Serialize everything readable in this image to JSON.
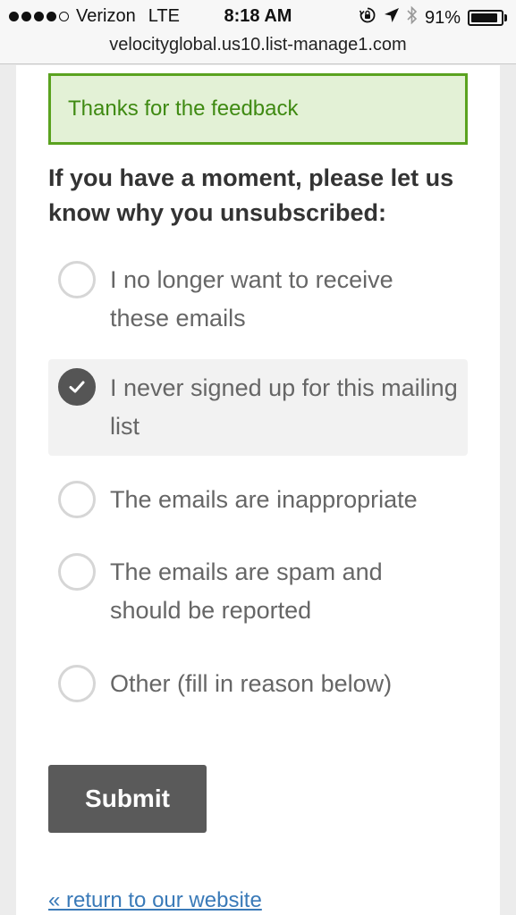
{
  "status_bar": {
    "carrier": "Verizon",
    "network": "LTE",
    "time": "8:18 AM",
    "battery": "91%",
    "battery_level": 0.91,
    "signal_bars_filled": 4,
    "signal_bars_total": 5,
    "icons": [
      "rotation-lock-icon",
      "location-arrow-icon",
      "bluetooth-icon",
      "battery-icon"
    ]
  },
  "browser": {
    "url": "velocityglobal.us10.list-manage1.com"
  },
  "alert": {
    "text": "Thanks for the feedback",
    "color": "#3f8a12"
  },
  "form": {
    "question": "If you have a moment, please let us know why you unsubscribed:",
    "options": [
      {
        "label": "I no longer want to receive these emails",
        "checked": false
      },
      {
        "label": "I never signed up for this mailing list",
        "checked": true
      },
      {
        "label": "The emails are inappropriate",
        "checked": false
      },
      {
        "label": "The emails are spam and should be reported",
        "checked": false
      },
      {
        "label": "Other (fill in reason below)",
        "checked": false
      }
    ],
    "submit_label": "Submit"
  },
  "footer": {
    "return_link": "« return to our website"
  }
}
